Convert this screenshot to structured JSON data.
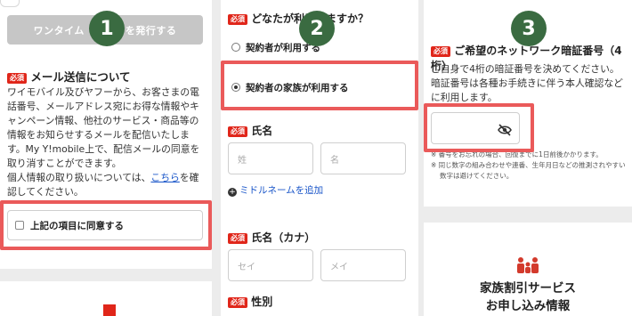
{
  "steps": {
    "one": "1",
    "two": "2",
    "three": "3"
  },
  "panel1": {
    "otp_button": "ワンタイム　　　　を発行する",
    "mail_title": "メール送信について",
    "mail_text_1": "ワイモバイル及びヤフーから、お客さまの電話番号、メールアドレス宛にお得な情報やキャンペーン情報、他社のサービス・商品等の情報をお知らせするメールを配信いたします。My Y!mobile上で、配信メールの同意を取り消すことができます。",
    "mail_text_2a": "個人情報の取り扱いについては、",
    "mail_link": "こちら",
    "mail_text_2b": "を確認してください。",
    "agree_label": "上記の項目に同意する"
  },
  "panel2": {
    "required": "必須",
    "question": "どなたが利用しますか？",
    "option_self": "契約者が利用する",
    "option_family": "契約者の家族が利用する",
    "name_label": "氏名",
    "last_name_placeholder": "姓",
    "first_name_placeholder": "名",
    "middle_name_link": "ミドルネームを追加",
    "kana_label": "氏名（カナ）",
    "last_kana_placeholder": "セイ",
    "first_kana_placeholder": "メイ",
    "gender_label": "性別"
  },
  "panel3": {
    "required": "必須",
    "pin_title": "ご希望のネットワーク暗証番号（4桁）",
    "pin_text": "ご自身で4桁の暗証番号を決めてください。暗証番号は各種お手続きに伴う本人確認などに利用します。",
    "note_1": "※ 番号をお忘れの場合、回復までに1日前後かかります。",
    "note_2": "※ 同じ数字の組み合わせや連番、生年月日などの推測されやすい数字は避けてください。",
    "family_title_1": "家族割引サービス",
    "family_title_2": "お申し込み情報"
  },
  "colors": {
    "accent_green": "#3a6b41",
    "highlight_red": "#ea5a5a",
    "required_red": "#e0261a",
    "link_blue": "#1a56c9"
  }
}
